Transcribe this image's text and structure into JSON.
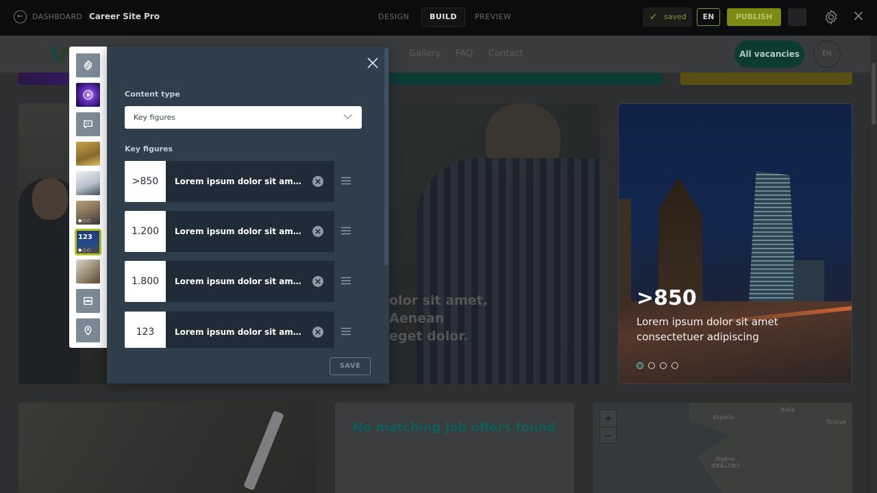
{
  "topbar": {
    "back_label": "DASHBOARD",
    "site_name": "Career Site Pro",
    "modes": [
      "DESIGN",
      "BUILD",
      "PREVIEW"
    ],
    "active_mode": "BUILD",
    "saved_label": "saved",
    "language": "EN",
    "publish_label": "PUBLISH",
    "icons": {
      "back": "arrow-left-circle-icon",
      "saved": "check-icon",
      "settings": "gear-icon",
      "close": "close-icon"
    }
  },
  "site_header": {
    "nav": [
      "Gallery",
      "FAQ",
      "Contact"
    ],
    "cta_label": "All vacancies",
    "language": "EN"
  },
  "page": {
    "center_tile_text": [
      "olor sit amet,",
      "Aenean",
      "eget dolor."
    ],
    "slider": {
      "figure": ">850",
      "text": "Lorem ipsum dolor sit amet consectetuer adipiscing",
      "slide_count": 4,
      "active_slide": 1
    },
    "no_jobs_message": "No matching job offers found",
    "map": {
      "zoom_in": "+",
      "zoom_out": "−",
      "labels": [
        "España",
        "Italia",
        "Türkiye",
        "Algérie",
        "ⵍⵣⵣⴰⵢⴻⵔ"
      ]
    }
  },
  "rail": {
    "selected_index": 6,
    "selected_badge": "123"
  },
  "modal": {
    "content_type_label": "Content type",
    "content_type_value": "Key figures",
    "key_figures_label": "Key figures",
    "key_figures": [
      {
        "value": ">850",
        "text": "Lorem ipsum dolor sit amet consectetuer adipiscing"
      },
      {
        "value": "1.200",
        "text": "Lorem ipsum dolor sit amet consectetuer adipiscing"
      },
      {
        "value": "1.800",
        "text": "Lorem ipsum dolor sit amet consectetuer adipiscing"
      },
      {
        "value": "123",
        "text": "Lorem ipsum dolor sit amet consectetuer adipiscing"
      }
    ],
    "save_label": "SAVE"
  },
  "colors": {
    "topbar_bg": "#0b0c0e",
    "accent_green": "#b1c221",
    "modal_bg": "#2e3e4b",
    "row_bg": "#1f2b36",
    "teal": "#0f5e58"
  }
}
